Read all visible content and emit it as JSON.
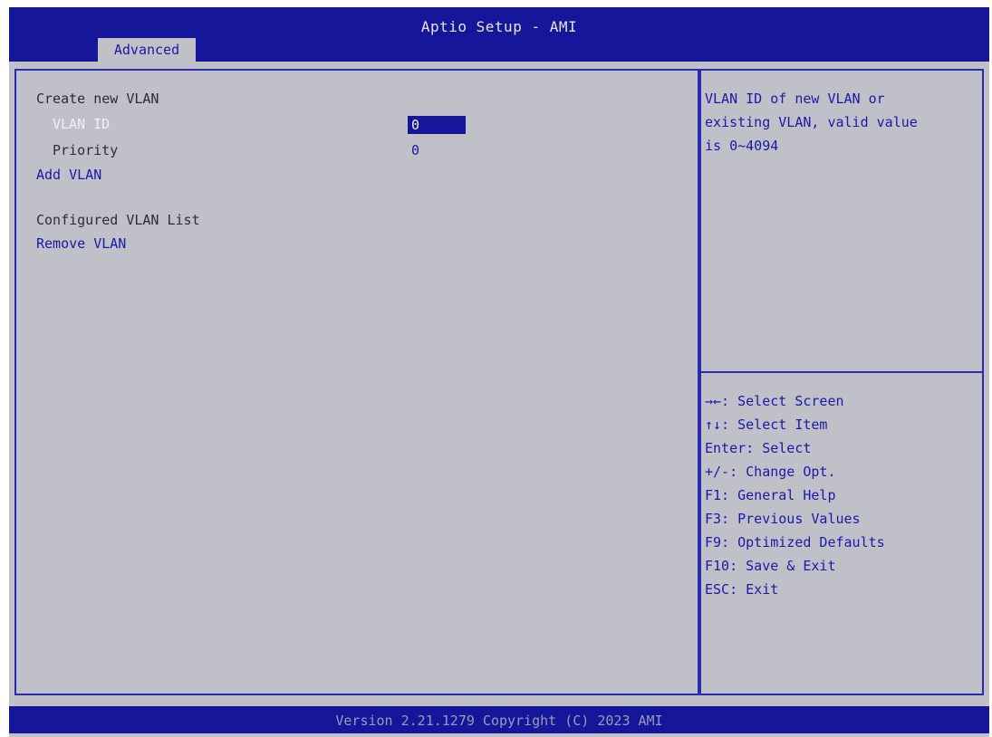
{
  "header": {
    "title": "Aptio Setup - AMI",
    "tab": "Advanced"
  },
  "main": {
    "create_heading": "Create new VLAN",
    "vlan_id_label": "VLAN ID",
    "vlan_id_value": "0",
    "priority_label": "Priority",
    "priority_value": "0",
    "add_vlan": "Add VLAN",
    "configured_heading": "Configured VLAN List",
    "remove_vlan": "Remove VLAN"
  },
  "help": {
    "lines": [
      "VLAN ID of new VLAN or",
      "existing VLAN, valid value",
      "is 0~4094"
    ]
  },
  "keys": [
    "→←: Select Screen",
    "↑↓: Select Item",
    "Enter: Select",
    "+/-: Change Opt.",
    "F1: General Help",
    "F3: Previous Values",
    "F9: Optimized Defaults",
    "F10: Save & Exit",
    "ESC: Exit"
  ],
  "footer": {
    "text": "Version 2.21.1279 Copyright (C) 2023 AMI"
  },
  "colors": {
    "bar": "#16169a",
    "panel": "#c0c0c8",
    "accent": "#1a1aa8"
  }
}
